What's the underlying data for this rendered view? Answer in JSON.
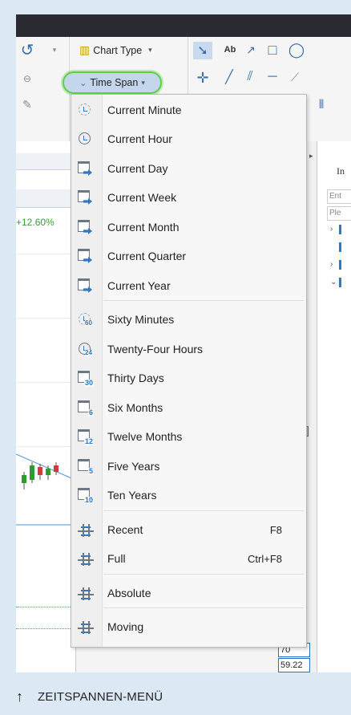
{
  "ribbon": {
    "chart_type_label": "Chart Type",
    "time_span_label": "Time Span",
    "text_tool_label": "Ab"
  },
  "left_pane": {
    "change_percent": "+12.60%"
  },
  "right_pane": {
    "header": "In",
    "field1": "Ent",
    "field2": "Ple"
  },
  "axis": {
    "value1": "70",
    "value2": "59.22"
  },
  "menu": {
    "items": [
      {
        "label": "Current Minute",
        "icon": "clock-dashed-icon"
      },
      {
        "label": "Current Hour",
        "icon": "clock-icon"
      },
      {
        "label": "Current Day",
        "icon": "calendar-arrow-icon"
      },
      {
        "label": "Current Week",
        "icon": "calendar-arrow-icon"
      },
      {
        "label": "Current Month",
        "icon": "calendar-arrow-icon"
      },
      {
        "label": "Current Quarter",
        "icon": "calendar-arrow-icon"
      },
      {
        "label": "Current Year",
        "icon": "calendar-arrow-icon"
      },
      {
        "label": "Sixty Minutes",
        "icon": "clock-60-icon",
        "badge": "60"
      },
      {
        "label": "Twenty-Four Hours",
        "icon": "clock-24-icon",
        "badge": "24"
      },
      {
        "label": "Thirty Days",
        "icon": "calendar-30-icon",
        "badge": "30"
      },
      {
        "label": "Six Months",
        "icon": "calendar-6-icon",
        "badge": "6"
      },
      {
        "label": "Twelve Months",
        "icon": "calendar-12-icon",
        "badge": "12"
      },
      {
        "label": "Five Years",
        "icon": "calendar-5-icon",
        "badge": "5"
      },
      {
        "label": "Ten Years",
        "icon": "calendar-10-icon",
        "badge": "10"
      },
      {
        "label": "Recent",
        "icon": "recent-range-icon",
        "shortcut": "F8"
      },
      {
        "label": "Full",
        "icon": "full-range-icon",
        "shortcut": "Ctrl+F8"
      },
      {
        "label": "Absolute",
        "icon": "absolute-range-icon"
      },
      {
        "label": "Moving",
        "icon": "moving-range-icon"
      }
    ]
  },
  "caption": {
    "arrow": "↑",
    "text": "ZEITSPANNEN-MENÜ"
  },
  "colors": {
    "highlight_ring": "#5cd04a",
    "accent_blue": "#2f78c4",
    "positive_green": "#3a9b3a"
  }
}
